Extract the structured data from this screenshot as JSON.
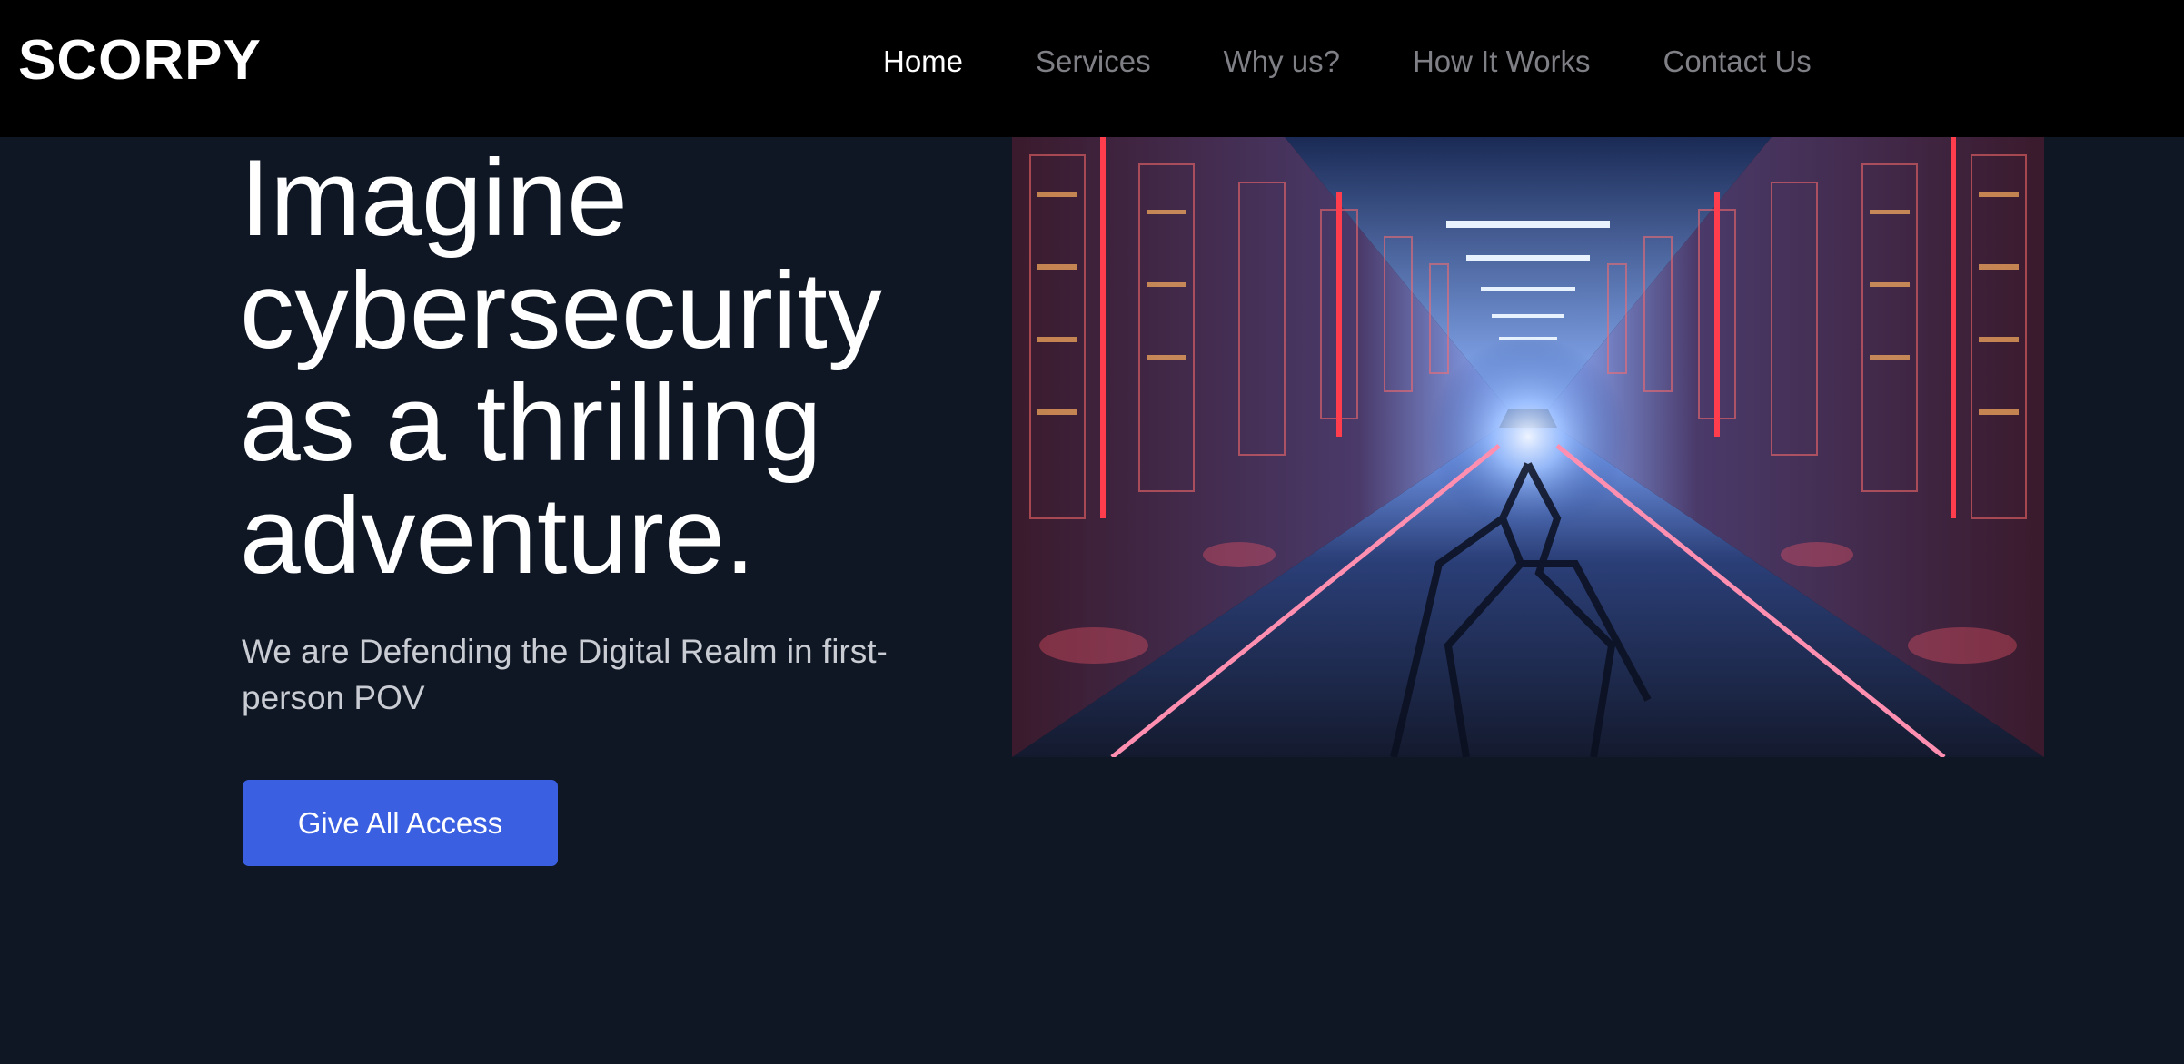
{
  "brand": {
    "logo": "SCORPY"
  },
  "nav": {
    "items": [
      {
        "label": "Home",
        "active": true
      },
      {
        "label": "Services",
        "active": false
      },
      {
        "label": "Why us?",
        "active": false
      },
      {
        "label": "How It Works",
        "active": false
      },
      {
        "label": "Contact Us",
        "active": false
      }
    ]
  },
  "hero": {
    "title_lines": [
      "Imagine",
      "cybersecurity",
      "as a thrilling",
      "adventure."
    ],
    "subtitle_lines": [
      "We are Defending the Digital Realm in first-",
      "person POV"
    ],
    "cta_label": "Give All Access",
    "image_icon": "server-corridor-image"
  },
  "colors": {
    "background": "#0f1724",
    "topbar": "#000000",
    "nav_active": "#ffffff",
    "nav_inactive": "#7f7f86",
    "cta": "#3a5fe0",
    "subtitle": "#c9ccd3"
  }
}
